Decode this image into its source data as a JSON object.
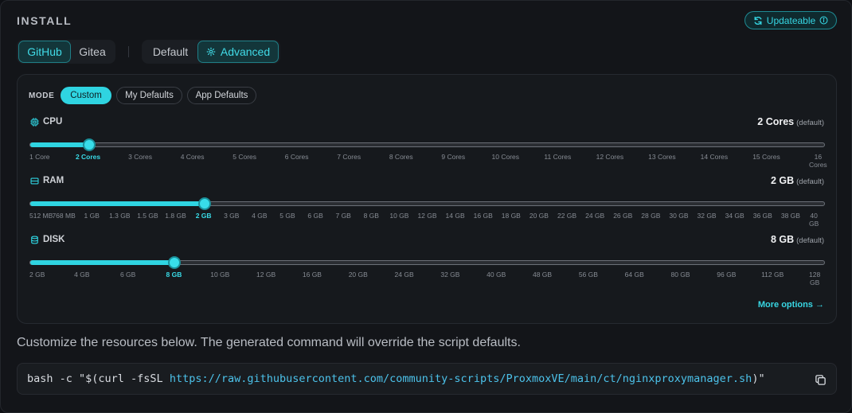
{
  "header": {
    "title": "INSTALL",
    "badge": "Updateable"
  },
  "source_tabs": [
    {
      "label": "GitHub",
      "active": true
    },
    {
      "label": "Gitea",
      "active": false
    }
  ],
  "mode_tabs": [
    {
      "label": "Default",
      "active": false
    },
    {
      "label": "Advanced",
      "active": true
    }
  ],
  "mode": {
    "label": "MODE",
    "options": [
      {
        "label": "Custom",
        "active": true
      },
      {
        "label": "My Defaults",
        "active": false
      },
      {
        "label": "App Defaults",
        "active": false
      }
    ]
  },
  "resources": {
    "cpu": {
      "label": "CPU",
      "value": "2 Cores",
      "default_note": "(default)",
      "selected_index": 1,
      "ticks": [
        "1 Core",
        "2 Cores",
        "3 Cores",
        "4 Cores",
        "5 Cores",
        "6 Cores",
        "7 Cores",
        "8 Cores",
        "9 Cores",
        "10 Cores",
        "11 Cores",
        "12 Cores",
        "13 Cores",
        "14 Cores",
        "15 Cores",
        "16 Cores"
      ]
    },
    "ram": {
      "label": "RAM",
      "value": "2 GB",
      "default_note": "(default)",
      "selected_index": 6,
      "ticks": [
        "512 MB",
        "768 MB",
        "1 GB",
        "1.3 GB",
        "1.5 GB",
        "1.8 GB",
        "2 GB",
        "3 GB",
        "4 GB",
        "5 GB",
        "6 GB",
        "7 GB",
        "8 GB",
        "10 GB",
        "12 GB",
        "14 GB",
        "16 GB",
        "18 GB",
        "20 GB",
        "22 GB",
        "24 GB",
        "26 GB",
        "28 GB",
        "30 GB",
        "32 GB",
        "34 GB",
        "36 GB",
        "38 GB",
        "40 GB"
      ]
    },
    "disk": {
      "label": "DISK",
      "value": "8 GB",
      "default_note": "(default)",
      "selected_index": 3,
      "ticks": [
        "2 GB",
        "4 GB",
        "6 GB",
        "8 GB",
        "10 GB",
        "12 GB",
        "16 GB",
        "20 GB",
        "24 GB",
        "32 GB",
        "40 GB",
        "48 GB",
        "56 GB",
        "64 GB",
        "80 GB",
        "96 GB",
        "112 GB",
        "128 GB"
      ]
    }
  },
  "more_options": "More options",
  "description": "Customize the resources below. The generated command will override the script defaults.",
  "command": {
    "prefix": "bash -c \"$(curl -fsSL ",
    "url": "https://raw.githubusercontent.com/community-scripts/ProxmoxVE/main/ct/nginxproxymanager.sh",
    "suffix": ")\""
  },
  "colors": {
    "accent": "#2fd4e1",
    "background": "#131519"
  }
}
